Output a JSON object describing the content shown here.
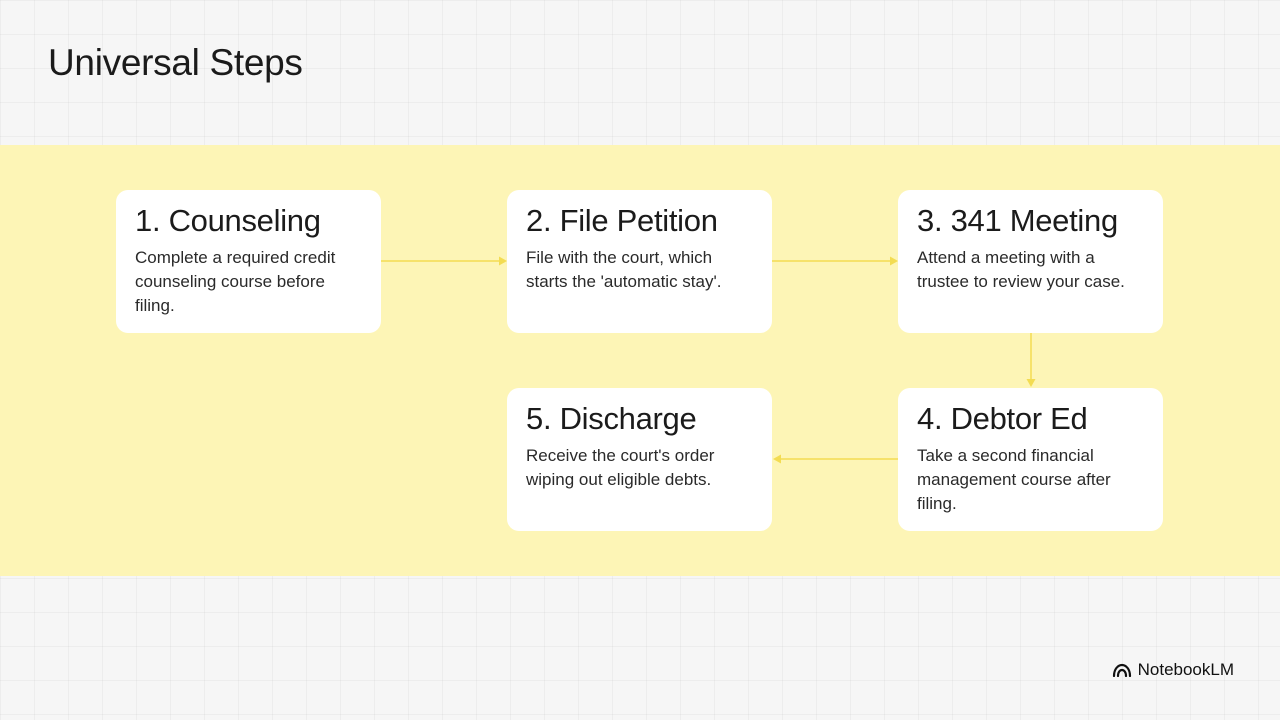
{
  "slide": {
    "title": "Universal Steps"
  },
  "steps": [
    {
      "title": "1. Counseling",
      "description": "Complete a required credit counseling course before filing."
    },
    {
      "title": "2. File Petition",
      "description": "File with the court, which starts the 'automatic stay'."
    },
    {
      "title": "3. 341 Meeting",
      "description": "Attend a meeting with a trustee to review your case."
    },
    {
      "title": "4. Debtor Ed",
      "description": "Take a second financial management course after filing."
    },
    {
      "title": "5. Discharge",
      "description": "Receive the court's order wiping out eligible debts."
    }
  ],
  "colors": {
    "band": "#fdf5b6",
    "connector": "#f3dc52",
    "card": "#ffffff"
  },
  "brand": {
    "name": "NotebookLM",
    "icon": "notebooklm-logo-icon"
  }
}
